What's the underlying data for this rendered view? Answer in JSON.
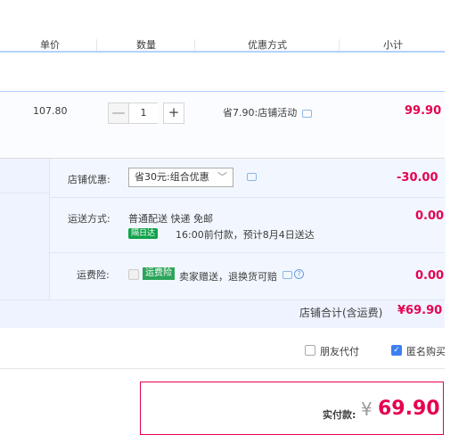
{
  "columns": {
    "unit_price": "单价",
    "quantity": "数量",
    "discount": "优惠方式",
    "subtotal": "小计"
  },
  "item": {
    "price": "107.80",
    "quantity": "1",
    "minus": "—",
    "plus": "+",
    "promo": "省7.90:店铺活动",
    "subtotal": "99.90"
  },
  "shop": {
    "coupon_label": "店铺优惠:",
    "coupon_select": "省30元:组合优惠",
    "coupon_amount": "-30.00",
    "shipping_label": "运送方式:",
    "shipping_method": "普通配送 快递 免邮",
    "shipping_badge": "隔日达",
    "shipping_note": "16:00前付款，预计8月4日送达",
    "shipping_amount": "0.00",
    "insurance_label": "运费险:",
    "insurance_badge": "运费险",
    "insurance_note": "卖家赠送，退换货可赔",
    "insurance_amount": "0.00",
    "total_label": "店铺合计(含运费)",
    "total_amount": "¥69.90"
  },
  "options": {
    "friend_pay": "朋友代付",
    "anonymous": "匿名购买"
  },
  "payment": {
    "label": "实付款:",
    "currency": "¥",
    "amount": "69.90"
  },
  "colors": {
    "accent_red": "#e5004f",
    "header_line": "#b2d1ff",
    "shop_bg": "#eef3ff",
    "check_blue": "#3d7ff2"
  }
}
